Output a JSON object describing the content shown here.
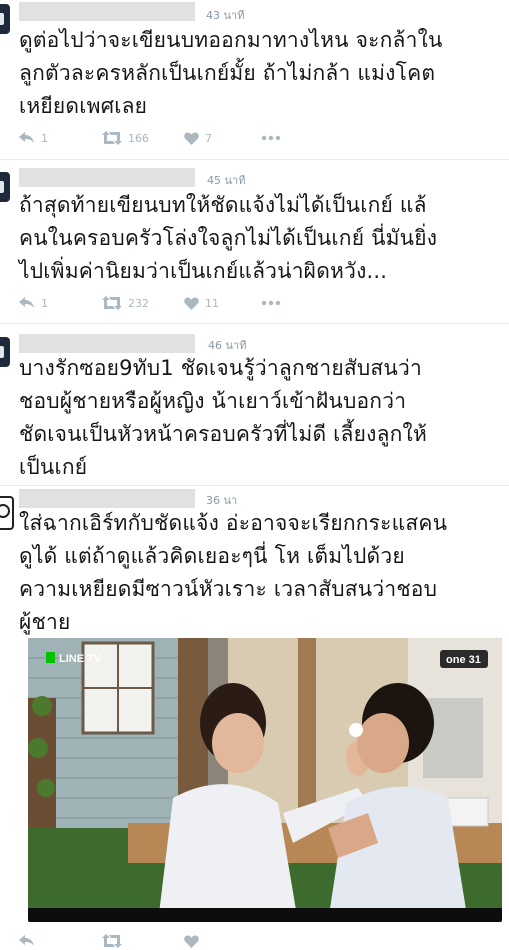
{
  "tweets": [
    {
      "time": "43 นาที",
      "text": "ดูต่อไปว่าจะเขียนบทออกมาทางไหน จะกล้าใน\nลูกตัวละครหลักเป็นเกย์มั้ย ถ้าไม่กล้า แม่งโคต\nเหยียดเพศเลย",
      "replies": "1",
      "retweets": "166",
      "likes": "7"
    },
    {
      "time": "45 นาที",
      "text": "ถ้าสุดท้ายเขียนบทให้ชัดแจ้งไม่ได้เป็นเกย์ แล้\nคนในครอบครัวโล่งใจลูกไม่ได้เป็นเกย์ นี่มันยิ่ง\nไปเพิ่มค่านิยมว่าเป็นเกย์แล้วน่าผิดหวัง...",
      "replies": "1",
      "retweets": "232",
      "likes": "11"
    },
    {
      "time": "46 นาที",
      "text": "บางรักซอย9ทับ1 ชัดเจนรู้ว่าลูกชายสับสนว่า\nชอบผู้ชายหรือผู้หญิง น้าเยาว์เข้าฝันบอกว่า\nชัดเจนเป็นหัวหน้าครอบครัวที่ไม่ดี เลี้ยงลูกให้\nเป็นเกย์"
    },
    {
      "time": "36 นา",
      "text": "ใส่ฉากเอิร์ทกับชัดแจ้ง อ่ะอาจจะเรียกกระแสคน\nดูได้ แต่ถ้าดูแล้วคิดเยอะๆนี่ โห เต็มไปด้วย\nความเหยียดมีซาวน์หัวเราะ เวลาสับสนว่าชอบ\nผู้ชาย",
      "media": {
        "watermark_left": "LINE TV",
        "watermark_right": "one 31"
      }
    }
  ],
  "colors": {
    "text": "#14171a",
    "muted": "#8899a6",
    "icon": "#aab8c2",
    "line_green": "#00c300"
  }
}
